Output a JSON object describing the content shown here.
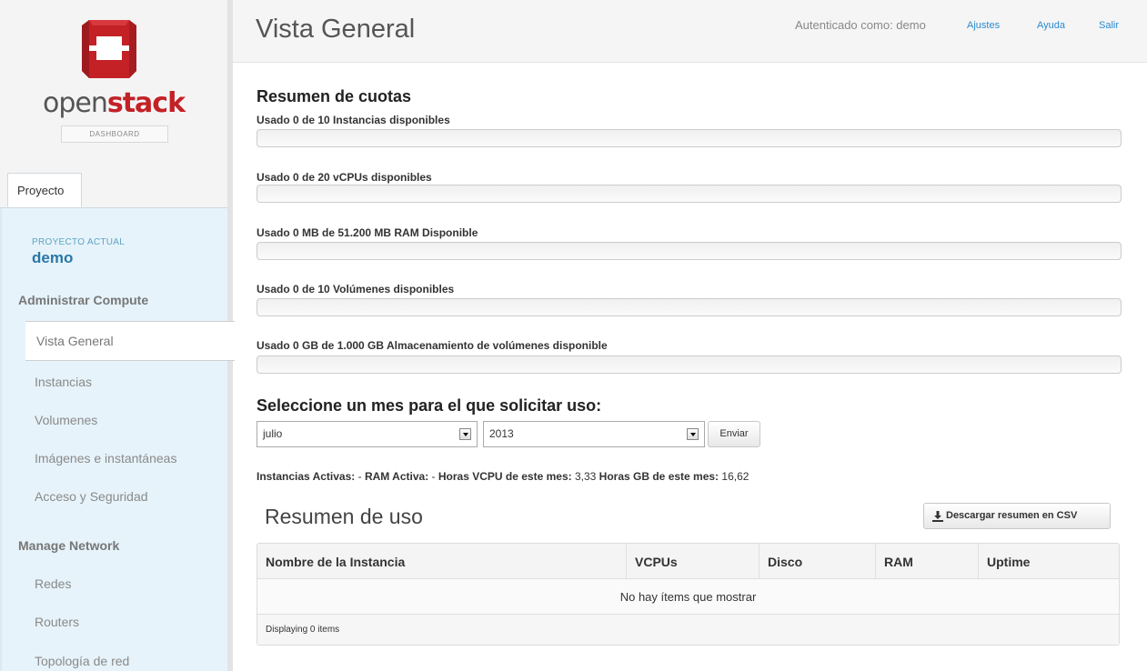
{
  "brand": {
    "word_open": "open",
    "word_stack": "stack",
    "subtitle": "DASHBOARD",
    "accent": "#c32126"
  },
  "sidebar": {
    "tab": "Proyecto",
    "current_project_label": "PROYECTO ACTUAL",
    "current_project": "demo",
    "sections": [
      {
        "title": "Administrar Compute",
        "items": [
          "Vista General",
          "Instancias",
          "Volumenes",
          "Imágenes e instantáneas",
          "Acceso y Seguridad"
        ],
        "active": "Vista General"
      },
      {
        "title": "Manage Network",
        "items": [
          "Redes",
          "Routers",
          "Topología de red"
        ]
      }
    ]
  },
  "header": {
    "title": "Vista General",
    "auth": "Autenticado como: demo",
    "links": [
      "Ajustes",
      "Ayuda",
      "Salir"
    ]
  },
  "quotas": {
    "title": "Resumen de cuotas",
    "items": [
      {
        "label": "Usado 0 de 10 Instancias disponibles",
        "used_fraction": 0
      },
      {
        "label": "Usado 0 de 20 vCPUs disponibles",
        "used_fraction": 0
      },
      {
        "label": "Usado 0 MB de 51.200 MB RAM Disponible",
        "used_fraction": 0
      },
      {
        "label": "Usado 0 de 10 Volúmenes disponibles",
        "used_fraction": 0
      },
      {
        "label": "Usado 0 GB de 1.000 GB Almacenamiento de volúmenes disponible",
        "used_fraction": 0
      }
    ]
  },
  "usage_form": {
    "title": "Seleccione un mes para el que solicitar uso:",
    "month": "julio",
    "year": "2013",
    "submit": "Enviar"
  },
  "stats": {
    "active_instances_label": "Instancias Activas:",
    "active_instances": "-",
    "active_ram_label": "RAM Activa:",
    "active_ram": "-",
    "vcpu_hours_label": "Horas VCPU de este mes:",
    "vcpu_hours": "3,33",
    "gb_hours_label": "Horas GB de este mes:",
    "gb_hours": "16,62"
  },
  "usage_summary": {
    "title": "Resumen de uso",
    "download_button": "Descargar resumen en CSV",
    "columns": [
      "Nombre de la Instancia",
      "VCPUs",
      "Disco",
      "RAM",
      "Uptime"
    ],
    "empty_message": "No hay ítems que mostrar",
    "footer": "Displaying 0 items"
  }
}
